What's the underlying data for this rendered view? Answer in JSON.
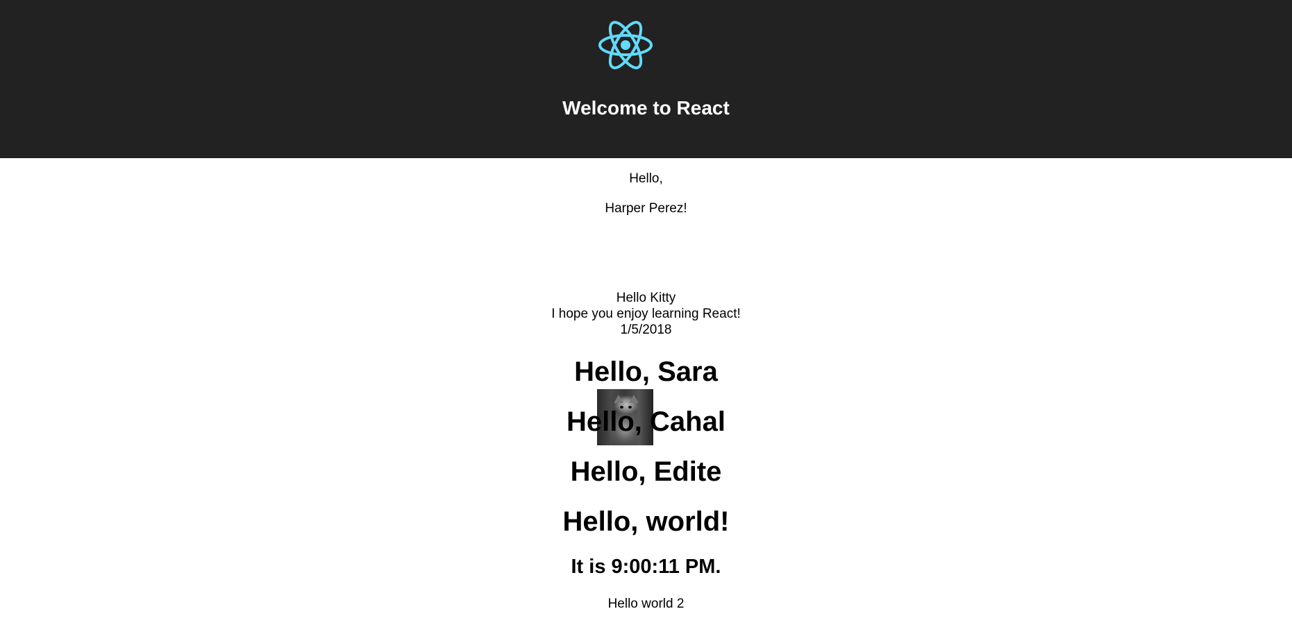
{
  "header": {
    "logo_icon": "react-atom-icon",
    "logo_color": "#61DAFB",
    "title": "Welcome to React",
    "background": "#222222"
  },
  "main": {
    "greeting_line1": "Hello,",
    "greeting_line2": "Harper Perez!",
    "avatar_alt": "Hello Kitty",
    "caption": "Hello Kitty",
    "comment_text": "I hope you enjoy learning React!",
    "comment_date": "1/5/2018",
    "welcomes": [
      "Hello, Sara",
      "Hello, Cahal",
      "Hello, Edite"
    ],
    "hello_world": "Hello, world!",
    "clock": "It is 9:00:11 PM.",
    "footer_text": "Hello world 2"
  }
}
